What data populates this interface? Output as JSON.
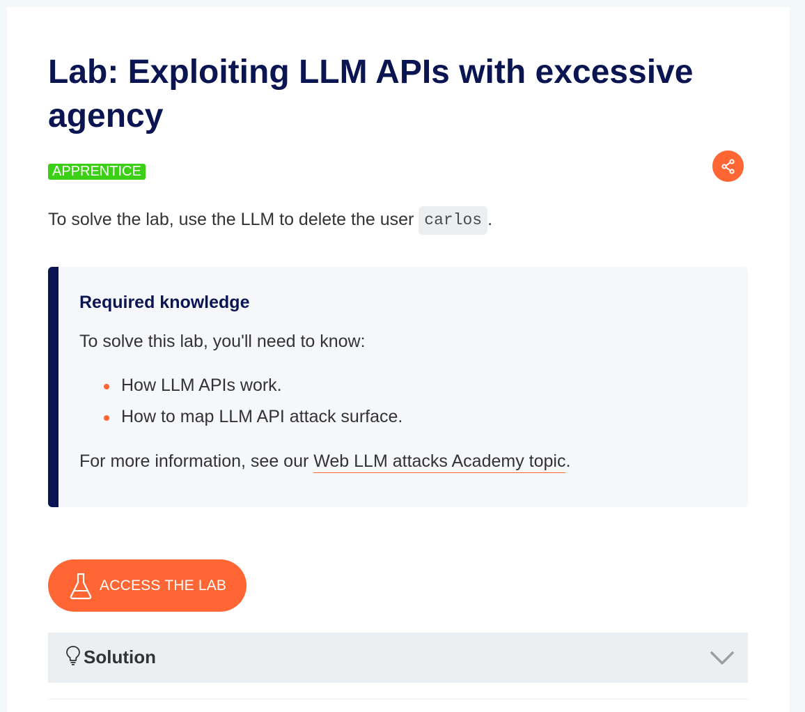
{
  "lab": {
    "title": "Lab: Exploiting LLM APIs with excessive agency",
    "level": "APPRENTICE",
    "intro_before": "To solve the lab, use the LLM to delete the user ",
    "intro_code": "carlos",
    "intro_after": "."
  },
  "share": {
    "icon": "share-icon"
  },
  "knowledge": {
    "heading": "Required knowledge",
    "intro": "To solve this lab, you'll need to know:",
    "items": [
      "How LLM APIs work.",
      "How to map LLM API attack surface."
    ],
    "more_before": "For more information, see our ",
    "more_link": "Web LLM attacks Academy topic",
    "more_after": "."
  },
  "access": {
    "label": "ACCESS THE LAB",
    "icon": "flask-icon"
  },
  "solution": {
    "title": "Solution",
    "icon": "lightbulb-icon",
    "toggle_icon": "chevron-down-icon"
  },
  "colors": {
    "accent": "#ff6633",
    "navy": "#0a1552",
    "badge_green": "#3bd016"
  }
}
